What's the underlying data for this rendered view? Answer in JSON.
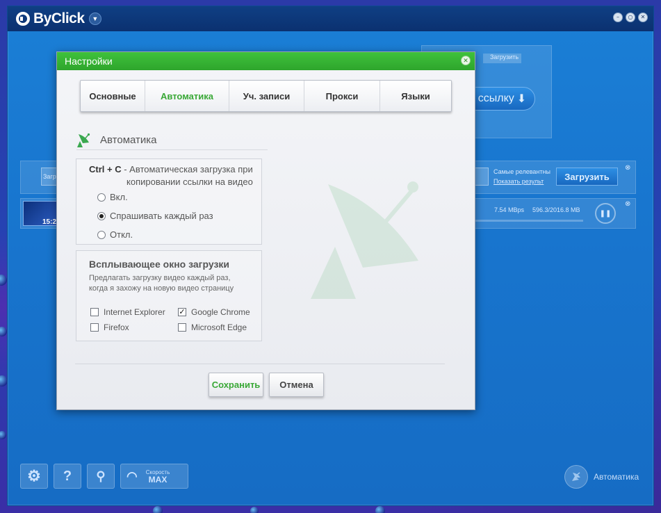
{
  "app": {
    "name": "ByClick",
    "background": {
      "upload_btn": "Загрузить",
      "link_btn": "ссылку",
      "search_short": "Загр",
      "relevance": "Самые релевантны",
      "show_results": "Показать результ",
      "download_btn": "Загрузить",
      "speed": "7.54 MBps",
      "size": "596.3/2016.8 MB",
      "time": "15:2"
    },
    "toolbar": {
      "speed_label": "Скорость",
      "speed_value": "MAX",
      "mode_label": "Автоматика"
    }
  },
  "dialog": {
    "title": "Настройки",
    "tabs": [
      {
        "label": "Основные",
        "active": false
      },
      {
        "label": "Автоматика",
        "active": true
      },
      {
        "label": "Уч. записи",
        "active": false
      },
      {
        "label": "Прокси",
        "active": false
      },
      {
        "label": "Языки",
        "active": false
      }
    ],
    "section_title": "Автоматика",
    "ctrl_c": {
      "hotkey": "Ctrl + C",
      "desc_line1": " - Автоматическая загрузка при",
      "desc_line2": "копировании ссылки на видео",
      "options": [
        {
          "label": "Вкл.",
          "selected": false
        },
        {
          "label": "Спрашивать каждый раз",
          "selected": true
        },
        {
          "label": "Откл.",
          "selected": false
        }
      ]
    },
    "popup": {
      "title": "Всплывающее окно загрузки",
      "desc_line1": "Предлагать загрузку видео каждый раз,",
      "desc_line2": "когда я захожу на новую видео страницу",
      "browsers": [
        {
          "label": "Internet Explorer",
          "checked": false
        },
        {
          "label": "Google Chrome",
          "checked": true
        },
        {
          "label": "Firefox",
          "checked": false
        },
        {
          "label": "Microsoft Edge",
          "checked": false
        }
      ]
    },
    "save_label": "Сохранить",
    "cancel_label": "Отмена"
  },
  "colors": {
    "accent_green": "#39a836",
    "title_green": "#33b030",
    "app_blue": "#1876cf"
  }
}
